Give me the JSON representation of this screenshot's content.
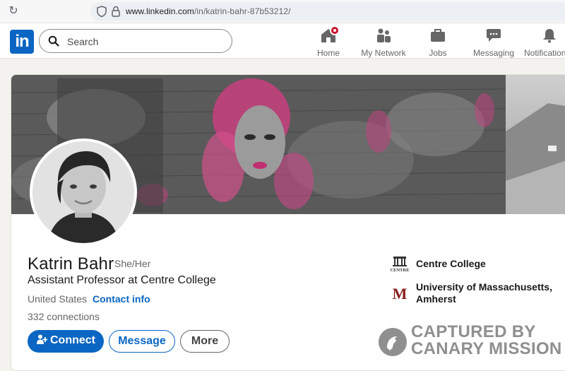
{
  "browser": {
    "url_host": "www.linkedin.com",
    "url_path": "/in/katrin-bahr-87b53212/"
  },
  "nav": {
    "logo_text": "in",
    "search_placeholder": "Search",
    "items": [
      {
        "label": "Home",
        "icon": "home-icon"
      },
      {
        "label": "My Network",
        "icon": "network-icon"
      },
      {
        "label": "Jobs",
        "icon": "briefcase-icon"
      },
      {
        "label": "Messaging",
        "icon": "messaging-icon"
      },
      {
        "label": "Notifications",
        "icon": "bell-icon"
      }
    ]
  },
  "profile": {
    "name": "Katrin Bahr",
    "pronouns": "She/Her",
    "headline": "Assistant Professor at Centre College",
    "location": "United States",
    "contact_info": "Contact info",
    "connections_count": "332",
    "connections_label": "connections",
    "buttons": {
      "connect": "Connect",
      "message": "Message",
      "more": "More"
    },
    "organizations": [
      {
        "name": "Centre College",
        "logo_text": "CENTRE"
      },
      {
        "name": "University of Massachusetts, Amherst",
        "logo_text": "M"
      }
    ]
  },
  "watermark": {
    "line1": "CAPTURED BY",
    "line2": "CANARY MISSION"
  },
  "colors": {
    "linkedin_blue": "#0a66c2",
    "notification_red": "#cb112d",
    "umass_maroon": "#881c1c"
  }
}
